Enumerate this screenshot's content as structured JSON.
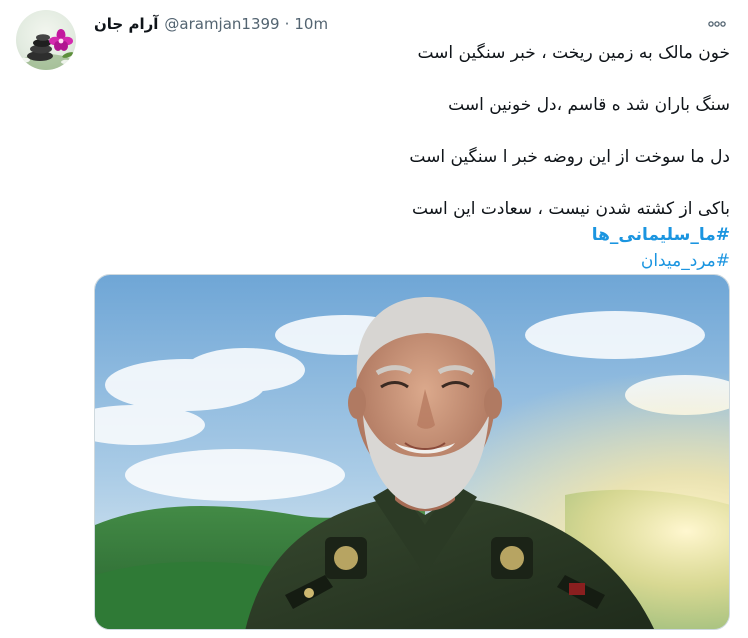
{
  "tweet": {
    "author": {
      "display_name": "آرام جان",
      "handle": "@aramjan1399"
    },
    "separator": "·",
    "timestamp": "10m",
    "text_lines": [
      "خون مالک به زمین ریخت ، خبر سنگین است",
      "سنگ باران شد ه قاسم ،دل خونین است",
      "دل ما سوخت از این روضه خبر ا سنگین است",
      "باکی از کشته شدن نیست ، سعادت این است"
    ],
    "hashtags": [
      "#ما_سلیمانی_ها",
      "#مرد_میدان"
    ]
  },
  "icons": {
    "more": "more-horizontal-icon",
    "avatar_image": "orchid-zen-stones"
  },
  "colors": {
    "link": "#1b95e0",
    "text": "#0f1419",
    "muted": "#536471",
    "border": "#cfd9de"
  }
}
